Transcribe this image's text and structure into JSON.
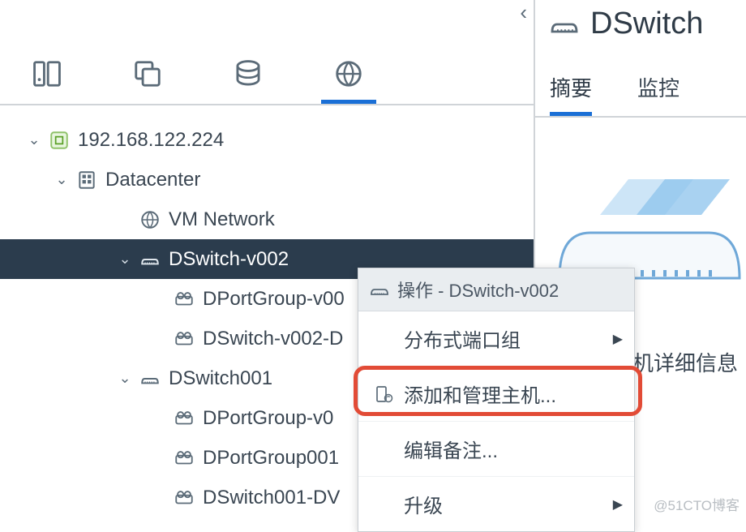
{
  "nav": {
    "collapse_glyph": "‹"
  },
  "tree": {
    "vcenter": {
      "label": "192.168.122.224"
    },
    "datacenter": {
      "label": "Datacenter"
    },
    "vmnetwork": {
      "label": "VM Network"
    },
    "dswitch_v002": {
      "label": "DSwitch-v002"
    },
    "dpg_v00": {
      "label": "DPortGroup-v00"
    },
    "dsw_v002_d": {
      "label": "DSwitch-v002-D"
    },
    "dswitch001": {
      "label": "DSwitch001"
    },
    "dpg001_v0": {
      "label": "DPortGroup-v0"
    },
    "dpg001": {
      "label": "DPortGroup001"
    },
    "dsw001_dv": {
      "label": "DSwitch001-DV"
    }
  },
  "header": {
    "title": "DSwitch"
  },
  "tabs": {
    "summary": "摘要",
    "monitor": "监控"
  },
  "detail": {
    "host_detail": "机详细信息"
  },
  "ctx": {
    "title": "操作 - DSwitch-v002",
    "portgroup": "分布式端口组",
    "addhosts": "添加和管理主机...",
    "notes": "编辑备注...",
    "upgrade": "升级"
  },
  "watermark": "@51CTO博客"
}
